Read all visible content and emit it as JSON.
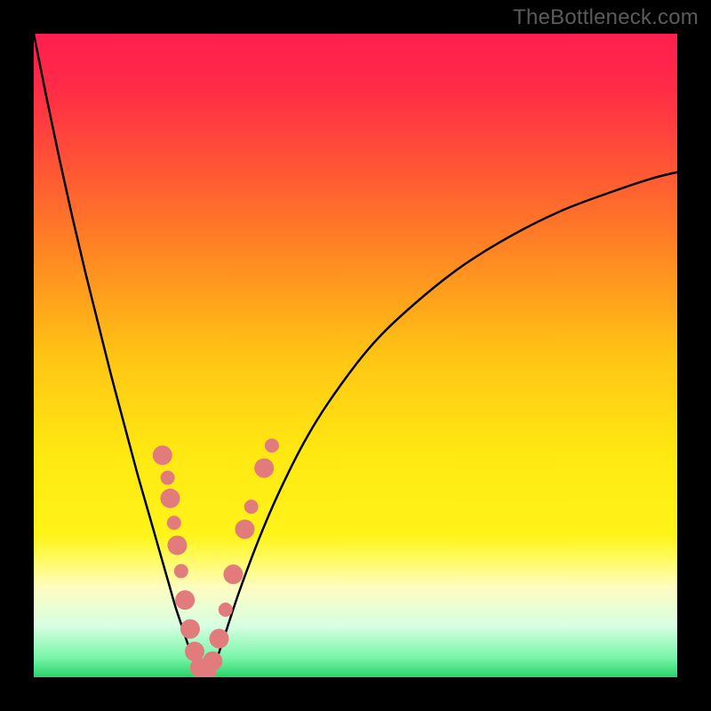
{
  "watermark": "TheBottleneck.com",
  "chart_data": {
    "type": "line",
    "title": "",
    "xlabel": "",
    "ylabel": "",
    "xlim": [
      0,
      100
    ],
    "ylim": [
      0,
      100
    ],
    "grid": false,
    "legend": false,
    "background_gradient": {
      "stops": [
        {
          "offset": 0.0,
          "color": "#ff1f4e"
        },
        {
          "offset": 0.08,
          "color": "#ff2a47"
        },
        {
          "offset": 0.2,
          "color": "#ff5236"
        },
        {
          "offset": 0.35,
          "color": "#ff8a22"
        },
        {
          "offset": 0.5,
          "color": "#ffc414"
        },
        {
          "offset": 0.65,
          "color": "#ffe812"
        },
        {
          "offset": 0.78,
          "color": "#fff41a"
        },
        {
          "offset": 0.82,
          "color": "#fffb6a"
        },
        {
          "offset": 0.86,
          "color": "#fffcc0"
        },
        {
          "offset": 0.92,
          "color": "#d7ffe2"
        },
        {
          "offset": 0.97,
          "color": "#77f5a8"
        },
        {
          "offset": 1.0,
          "color": "#29d36a"
        }
      ]
    },
    "series": [
      {
        "name": "left-branch",
        "stroke": "#000000",
        "stroke_width": 2.5,
        "x": [
          0.0,
          2.0,
          4.0,
          6.0,
          8.0,
          10.0,
          12.0,
          14.0,
          16.0,
          18.0,
          20.0,
          21.0,
          22.0,
          23.0,
          24.0,
          25.0,
          25.8
        ],
        "y": [
          100.0,
          90.0,
          80.5,
          71.5,
          63.0,
          55.0,
          47.0,
          39.5,
          32.0,
          25.0,
          18.0,
          14.5,
          11.0,
          8.0,
          5.0,
          2.5,
          0.5
        ]
      },
      {
        "name": "right-branch",
        "stroke": "#000000",
        "stroke_width": 2.5,
        "x": [
          27.5,
          28.5,
          30.0,
          32.0,
          35.0,
          38.0,
          42.0,
          46.0,
          52.0,
          58.0,
          66.0,
          74.0,
          82.0,
          90.0,
          96.0,
          100.0
        ],
        "y": [
          0.5,
          3.0,
          7.5,
          13.5,
          21.5,
          28.5,
          36.5,
          43.0,
          51.0,
          57.0,
          63.5,
          68.5,
          72.5,
          75.5,
          77.5,
          78.5
        ]
      }
    ],
    "highlight_points": {
      "color": "#e27b7b",
      "radius_large": 11,
      "radius_small": 8,
      "points": [
        {
          "x": 20.0,
          "y": 34.5,
          "r": 11
        },
        {
          "x": 20.8,
          "y": 31.0,
          "r": 8
        },
        {
          "x": 21.2,
          "y": 27.8,
          "r": 11
        },
        {
          "x": 21.8,
          "y": 24.0,
          "r": 8
        },
        {
          "x": 22.3,
          "y": 20.5,
          "r": 11
        },
        {
          "x": 22.9,
          "y": 16.5,
          "r": 8
        },
        {
          "x": 23.5,
          "y": 12.0,
          "r": 11
        },
        {
          "x": 24.3,
          "y": 7.5,
          "r": 11
        },
        {
          "x": 25.0,
          "y": 4.0,
          "r": 11
        },
        {
          "x": 25.8,
          "y": 1.5,
          "r": 11
        },
        {
          "x": 26.8,
          "y": 0.8,
          "r": 11
        },
        {
          "x": 27.8,
          "y": 2.5,
          "r": 11
        },
        {
          "x": 28.8,
          "y": 6.0,
          "r": 11
        },
        {
          "x": 29.8,
          "y": 10.5,
          "r": 8
        },
        {
          "x": 31.0,
          "y": 16.0,
          "r": 11
        },
        {
          "x": 32.8,
          "y": 23.0,
          "r": 11
        },
        {
          "x": 33.8,
          "y": 26.5,
          "r": 8
        },
        {
          "x": 35.8,
          "y": 32.5,
          "r": 11
        },
        {
          "x": 37.0,
          "y": 36.0,
          "r": 8
        }
      ]
    }
  }
}
